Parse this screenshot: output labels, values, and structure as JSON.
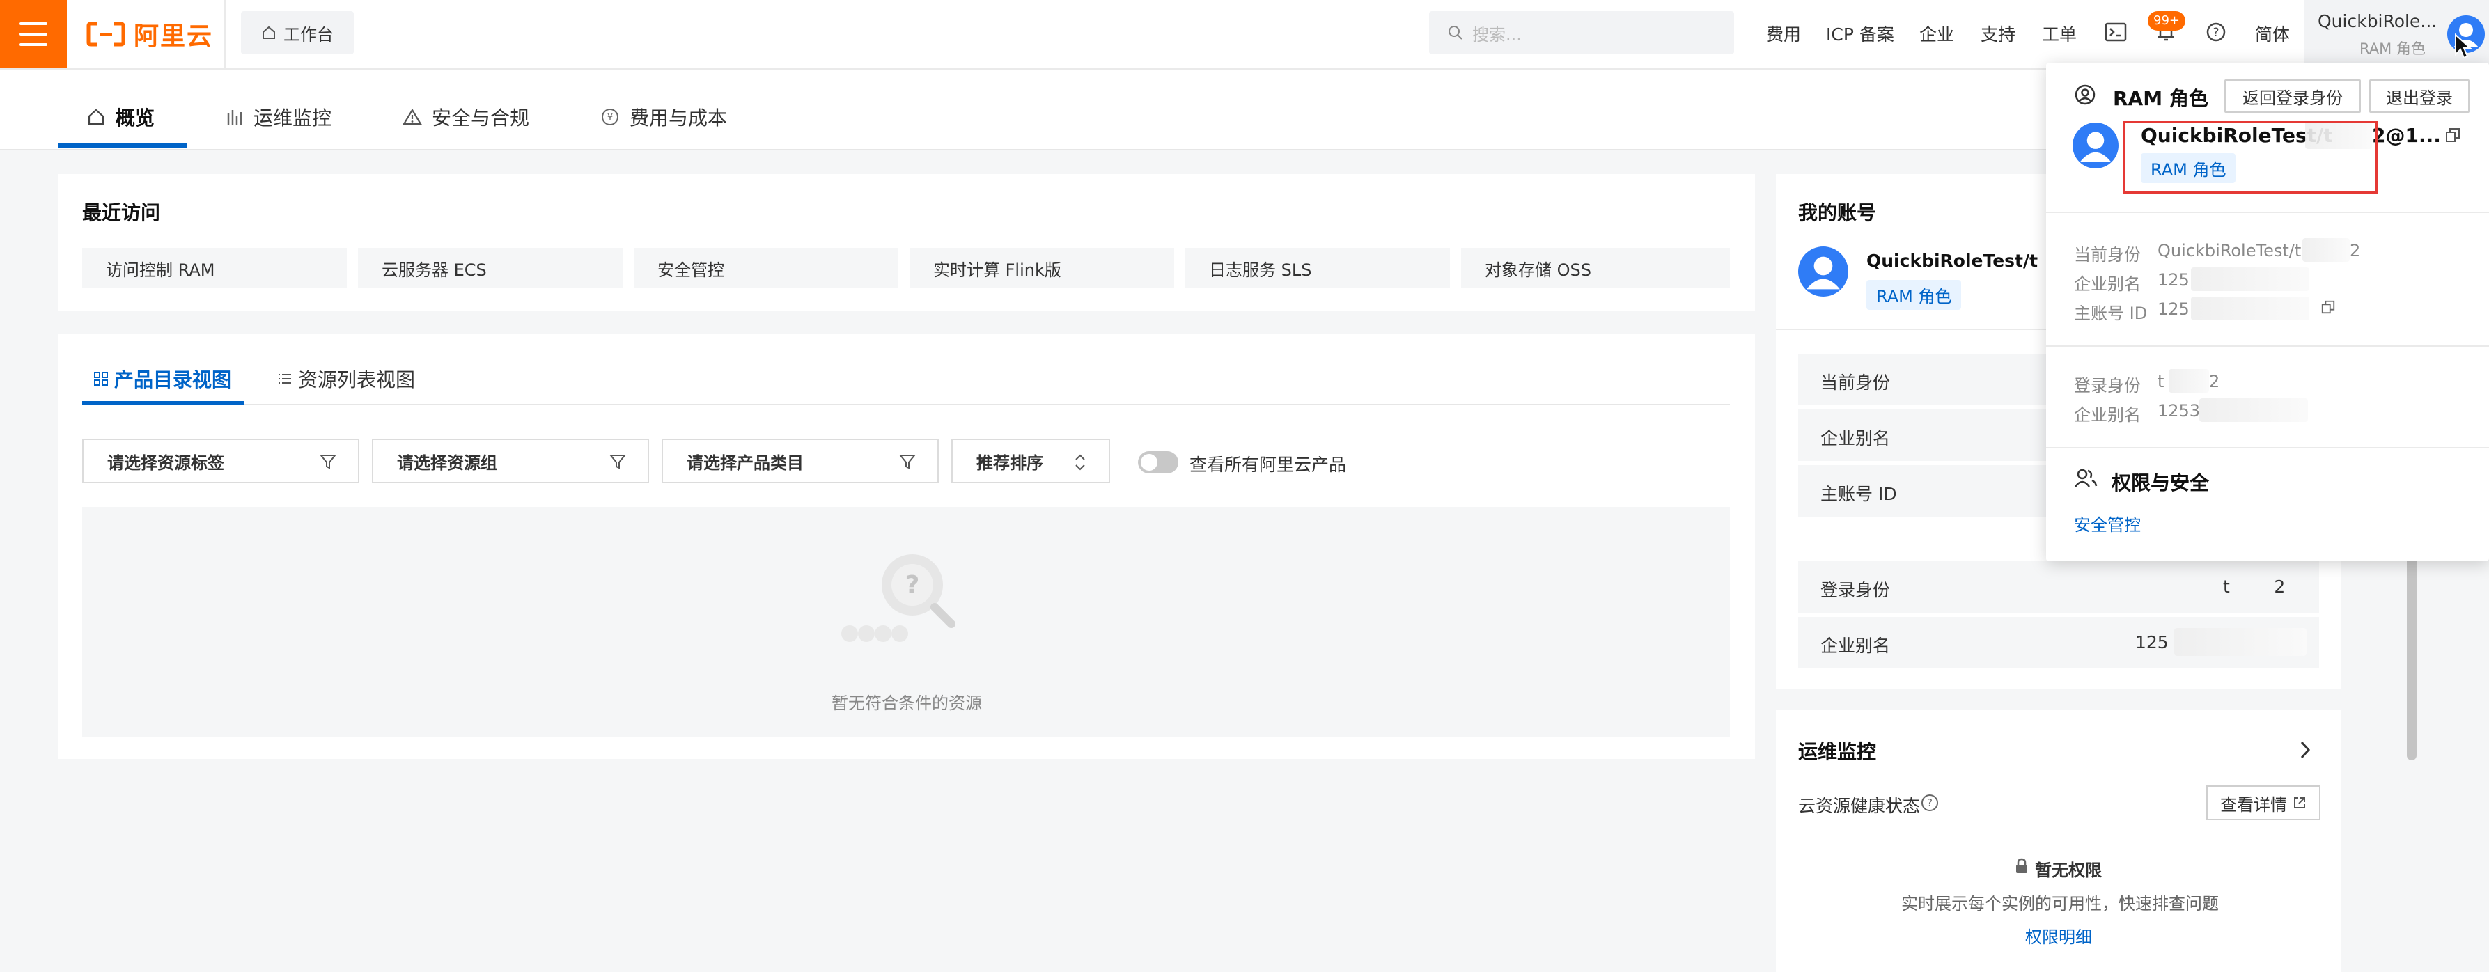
{
  "topbar": {
    "logo_text": "阿里云",
    "workbench_label": "工作台",
    "search_placeholder": "搜索...",
    "nav": [
      "费用",
      "ICP 备案",
      "企业",
      "支持",
      "工单"
    ],
    "notification_badge": "99+",
    "language": "简体",
    "user_name": "QuickbiRole...",
    "user_role": "RAM 角色"
  },
  "subtabs": [
    {
      "label": "概览",
      "icon": "home-icon",
      "active": true
    },
    {
      "label": "运维监控",
      "icon": "bar-chart-icon",
      "active": false
    },
    {
      "label": "安全与合规",
      "icon": "warning-triangle-icon",
      "active": false
    },
    {
      "label": "费用与成本",
      "icon": "yen-coin-icon",
      "active": false
    }
  ],
  "recent": {
    "title": "最近访问",
    "items": [
      "访问控制 RAM",
      "云服务器 ECS",
      "安全管控",
      "实时计算 Flink版",
      "日志服务 SLS",
      "对象存储 OSS"
    ]
  },
  "products": {
    "view_tabs": [
      {
        "label": "产品目录视图",
        "active": true
      },
      {
        "label": "资源列表视图",
        "active": false
      }
    ],
    "filters": [
      "请选择资源标签",
      "请选择资源组",
      "请选择产品类目"
    ],
    "sort_label": "推荐排序",
    "toggle_label": "查看所有阿里云产品",
    "empty_text": "暂无符合条件的资源"
  },
  "account": {
    "title": "我的账号",
    "name": "QuickbiRoleTest/t",
    "role_tag": "RAM 角色",
    "rows1": [
      {
        "label": "当前身份",
        "value": ""
      },
      {
        "label": "企业别名",
        "value": ""
      },
      {
        "label": "主账号 ID",
        "value": ""
      }
    ],
    "rows2": [
      {
        "label": "登录身份",
        "value": "t        2"
      },
      {
        "label": "企业别名",
        "value": "125"
      }
    ]
  },
  "ops": {
    "title": "运维监控",
    "health_label": "云资源健康状态",
    "detail_button": "查看详情",
    "no_perm_title": "暂无权限",
    "no_perm_desc": "实时展示每个实例的可用性，快速排查问题",
    "perm_link": "权限明细"
  },
  "dropdown": {
    "header": "RAM 角色",
    "btn_return": "返回登录身份",
    "btn_logout": "退出登录",
    "display_name": "QuickbiRoleTest/t",
    "display_name_tail": "2@1...",
    "role_tag": "RAM 角色",
    "section1": [
      {
        "label": "当前身份",
        "value": "QuickbiRoleTest/t",
        "tail": "2"
      },
      {
        "label": "企业别名",
        "value": "125",
        "tail": ""
      },
      {
        "label": "主账号 ID",
        "value": "125",
        "tail": ""
      }
    ],
    "section2": [
      {
        "label": "登录身份",
        "value": "t",
        "tail": "2"
      },
      {
        "label": "企业别名",
        "value": "1253",
        "tail": ""
      }
    ],
    "security_title": "权限与安全",
    "security_link": "安全管控"
  },
  "colors": {
    "brand": "#ff6a00",
    "primary": "#0064c8",
    "highlight": "#e53935"
  }
}
